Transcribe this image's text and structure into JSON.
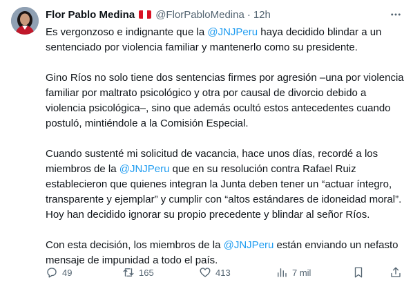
{
  "author": {
    "name": "Flor Pablo Medina",
    "handle": "@FlorPabloMedina",
    "separator": "·",
    "time": "12h"
  },
  "body": {
    "p1": [
      "Es vergonzoso e indignante que la ",
      "@JNJPeru",
      " haya decidido blindar a un sentenciado por violencia familiar y mantenerlo como su presidente."
    ],
    "p2": "Gino Ríos no solo tiene dos sentencias firmes por agresión –una por violencia familiar por maltrato psicológico y otra por causal de divorcio debido a violencia psicológica–, sino que además ocultó estos antecedentes cuando postuló, mintiéndole a la Comisión Especial.",
    "p3": [
      "Cuando sustenté mi solicitud de vacancia, hace unos días, recordé a los miembros de la ",
      "@JNJPeru",
      " que en su resolución contra Rafael Ruiz establecieron que quienes integran la Junta deben tener un “actuar íntegro, transparente y ejemplar” y cumplir con “altos estándares de idoneidad moral”. Hoy han decidido ignorar su propio precedente y blindar al señor Ríos."
    ],
    "p4": [
      "Con esta decisión, los miembros de la ",
      "@JNJPeru",
      " están enviando un nefasto mensaje de impunidad a todo el país."
    ]
  },
  "actions": {
    "replies": "49",
    "retweets": "165",
    "likes": "413",
    "views": "7 mil"
  },
  "colors": {
    "text": "#0f1419",
    "secondary": "#536471",
    "link": "#1d9bf0"
  },
  "icons": [
    "reply-icon",
    "retweet-icon",
    "like-icon",
    "views-icon",
    "bookmark-icon",
    "share-icon",
    "more-icon",
    "peru-flag"
  ]
}
